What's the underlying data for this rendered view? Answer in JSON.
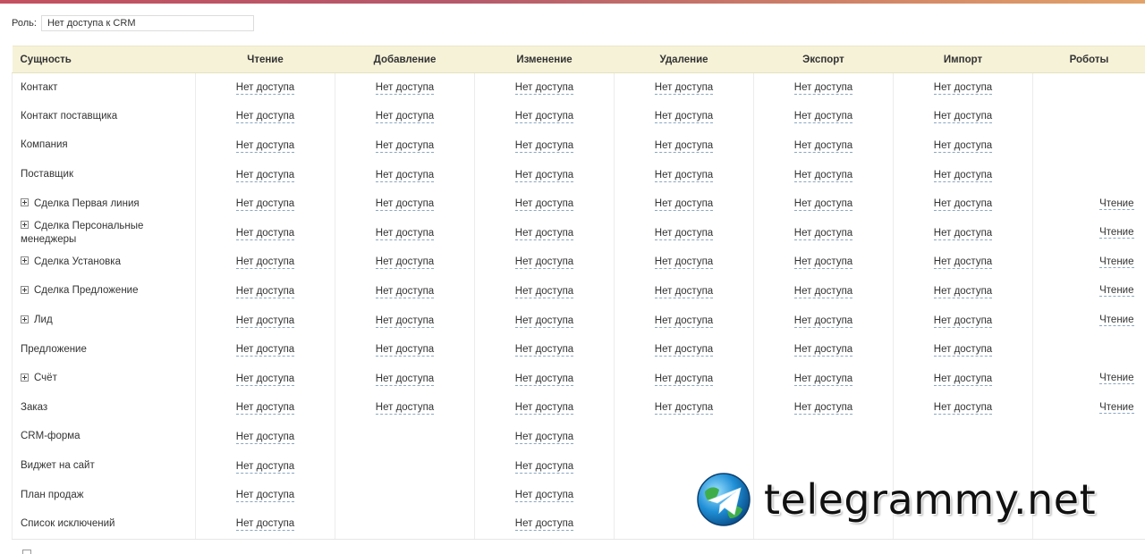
{
  "role": {
    "label": "Роль:",
    "value": "Нет доступа к CRM"
  },
  "table": {
    "headers": [
      "Сущность",
      "Чтение",
      "Добавление",
      "Изменение",
      "Удаление",
      "Экспорт",
      "Импорт",
      "Роботы"
    ],
    "no_access": "Нет доступа",
    "robot_read": "Чтение",
    "rows": [
      {
        "entity": "Контакт",
        "expandable": false,
        "cells": [
          true,
          true,
          true,
          true,
          true,
          true
        ],
        "robot": false
      },
      {
        "entity": "Контакт поставщика",
        "expandable": false,
        "cells": [
          true,
          true,
          true,
          true,
          true,
          true
        ],
        "robot": false
      },
      {
        "entity": "Компания",
        "expandable": false,
        "cells": [
          true,
          true,
          true,
          true,
          true,
          true
        ],
        "robot": false
      },
      {
        "entity": "Поставщик",
        "expandable": false,
        "cells": [
          true,
          true,
          true,
          true,
          true,
          true
        ],
        "robot": false
      },
      {
        "entity": "Сделка Первая линия",
        "expandable": true,
        "cells": [
          true,
          true,
          true,
          true,
          true,
          true
        ],
        "robot": true
      },
      {
        "entity": "Сделка Персональные менеджеры",
        "expandable": true,
        "cells": [
          true,
          true,
          true,
          true,
          true,
          true
        ],
        "robot": true
      },
      {
        "entity": "Сделка Установка",
        "expandable": true,
        "cells": [
          true,
          true,
          true,
          true,
          true,
          true
        ],
        "robot": true
      },
      {
        "entity": "Сделка Предложение",
        "expandable": true,
        "cells": [
          true,
          true,
          true,
          true,
          true,
          true
        ],
        "robot": true
      },
      {
        "entity": "Лид",
        "expandable": true,
        "cells": [
          true,
          true,
          true,
          true,
          true,
          true
        ],
        "robot": true
      },
      {
        "entity": "Предложение",
        "expandable": false,
        "cells": [
          true,
          true,
          true,
          true,
          true,
          true
        ],
        "robot": false
      },
      {
        "entity": "Счёт",
        "expandable": true,
        "cells": [
          true,
          true,
          true,
          true,
          true,
          true
        ],
        "robot": true
      },
      {
        "entity": "Заказ",
        "expandable": false,
        "cells": [
          true,
          true,
          true,
          true,
          true,
          true
        ],
        "robot": true
      },
      {
        "entity": "CRM-форма",
        "expandable": false,
        "cells": [
          true,
          false,
          true,
          false,
          false,
          false
        ],
        "robot": false
      },
      {
        "entity": "Виджет на сайт",
        "expandable": false,
        "cells": [
          true,
          false,
          true,
          false,
          false,
          false
        ],
        "robot": false
      },
      {
        "entity": "План продаж",
        "expandable": false,
        "cells": [
          true,
          false,
          true,
          false,
          false,
          false
        ],
        "robot": false
      },
      {
        "entity": "Список исключений",
        "expandable": false,
        "cells": [
          true,
          false,
          true,
          false,
          false,
          false
        ],
        "robot": false
      }
    ]
  },
  "watermark": {
    "text": "telegrammy.net",
    "icon": "telegram-logo-icon"
  },
  "colors": {
    "header_bg": "#f6f2d8",
    "link_underline": "#8aa7c2",
    "stripe_start": "#c4515f",
    "stripe_end": "#e2a36a"
  }
}
